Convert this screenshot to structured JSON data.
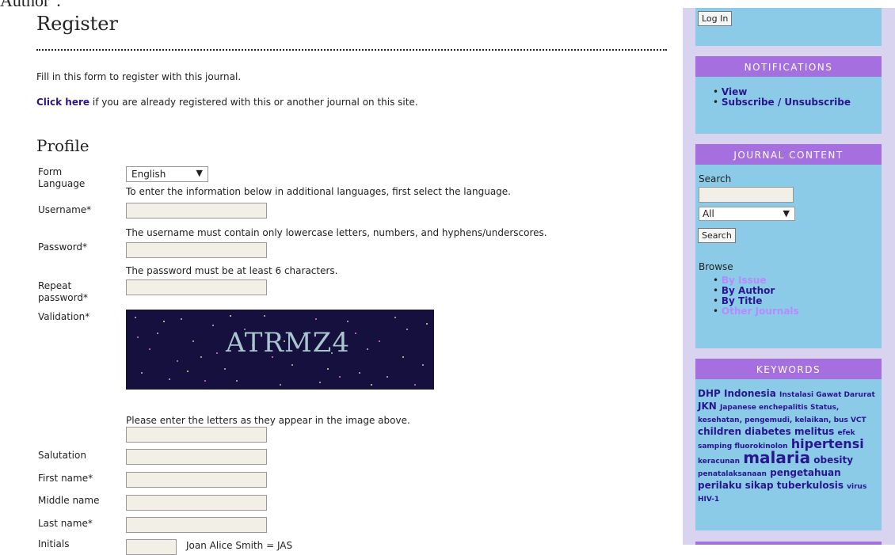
{
  "top_clip_text": "Author\".",
  "page": {
    "title": "Register",
    "intro": "Fill in this form to register with this journal.",
    "login_link": "Click here",
    "login_text": " if you are already registered with this or another journal on this site."
  },
  "profile": {
    "heading": "Profile",
    "form_language_label_1": "Form",
    "form_language_label_2": "Language",
    "form_language_value": "English",
    "form_language_hint": "To enter the information below in additional languages, first select the language.",
    "username_label": "Username*",
    "username_hint": "The username must contain only lowercase letters, numbers, and hyphens/underscores.",
    "password_label": "Password*",
    "password_hint": "The password must be at least 6 characters.",
    "repeat_label_1": "Repeat",
    "repeat_label_2": "password*",
    "validation_label": "Validation*",
    "captcha_text": "ATRMZ4",
    "validation_hint": "Please enter the letters as they appear in the image above.",
    "salutation_label": "Salutation",
    "first_name_label": "First name*",
    "middle_name_label": "Middle name",
    "last_name_label": "Last name*",
    "initials_label": "Initials",
    "initials_hint": "Joan Alice Smith = JAS"
  },
  "sidebar": {
    "login_button": "Log In",
    "notifications": {
      "title": "NOTIFICATIONS",
      "view": "View",
      "subscribe": "Subscribe / Unsubscribe"
    },
    "journal_content": {
      "title": "JOURNAL CONTENT",
      "search_label": "Search",
      "scope_value": "All",
      "search_button": "Search",
      "browse_label": "Browse",
      "by_issue": "By Issue",
      "by_author": "By Author",
      "by_title": "By Title",
      "other_journals": "Other Journals"
    },
    "keywords": {
      "title": "KEYWORDS",
      "k1": "DHP Indonesia",
      "k2": "Instalasi Gawat Darurat",
      "k3": "JKN",
      "k4": "Japanese enchepalitis Status, kesehatan, pengemudi, kelaikan, bus VCT",
      "k5": "children",
      "k6": "diabetes melitus",
      "k7": "efek samping fluorokinolon",
      "k8": "hipertensi",
      "k9": "keracunan",
      "k10": "malaria",
      "k11": "obesity",
      "k12": "penatalaksanaan",
      "k13": "pengetahuan",
      "k14": "perilaku sikap tuberkulosis",
      "k15": "virus HIV-1"
    }
  }
}
